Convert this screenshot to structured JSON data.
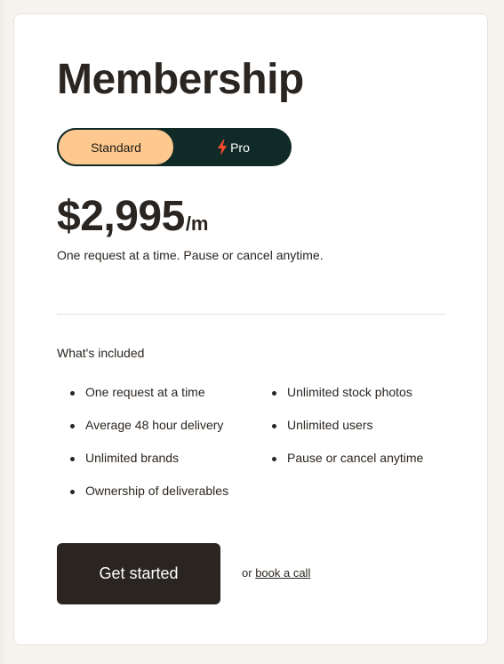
{
  "title": "Membership",
  "plan_toggle": {
    "options": [
      {
        "label": "Standard",
        "selected": true
      },
      {
        "label": "Pro",
        "selected": false,
        "icon": "lightning-bolt-icon"
      }
    ]
  },
  "price": {
    "amount": "$2,995",
    "period": "/m"
  },
  "tagline": "One request at a time. Pause or cancel anytime.",
  "included": {
    "heading": "What's included",
    "left_column": [
      "One request at a time",
      "Average 48 hour delivery",
      "Unlimited brands",
      "Ownership of deliverables"
    ],
    "right_column": [
      "Unlimited stock photos",
      "Unlimited users",
      "Pause or cancel anytime"
    ]
  },
  "cta": {
    "label": "Get started",
    "alt_prefix": "or",
    "alt_link": "book a call"
  },
  "colors": {
    "accent": "#fec98f",
    "toggle_bg": "#102a27",
    "bolt": "#ff4d2e",
    "button_bg": "#2a2521"
  }
}
